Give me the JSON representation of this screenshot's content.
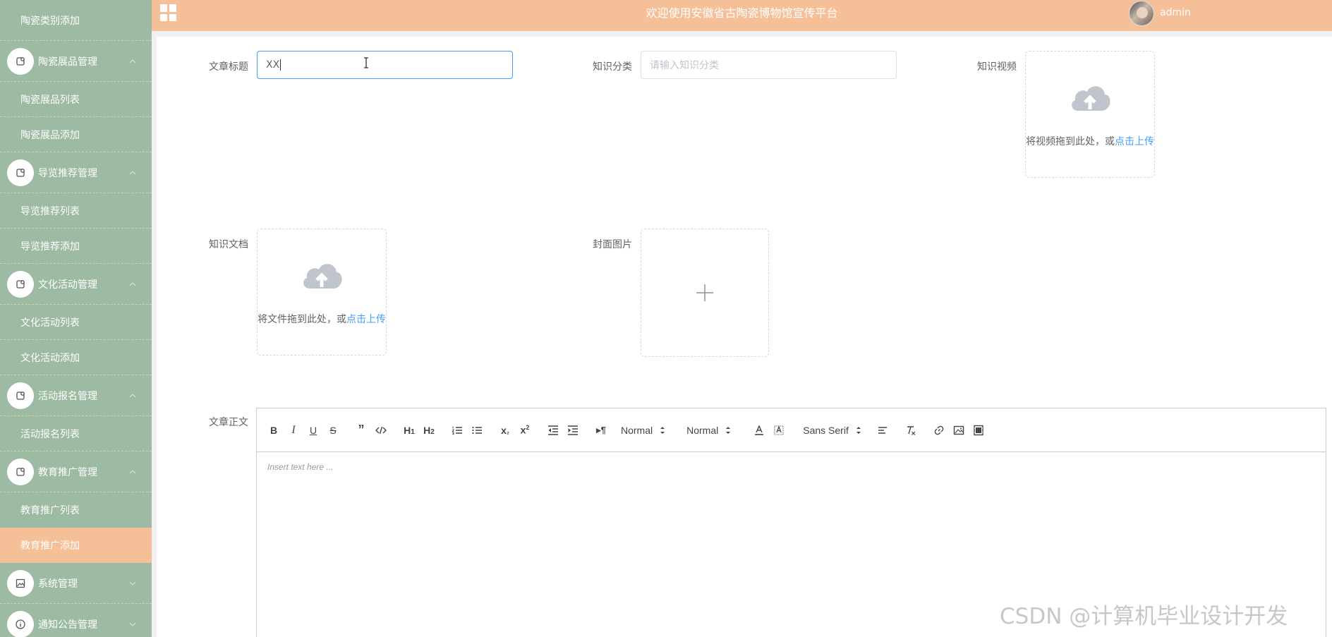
{
  "header": {
    "title": "欢迎使用安徽省古陶瓷博物馆宣传平台",
    "username": "admin",
    "accent_color": "#f5bf98"
  },
  "sidebar": {
    "background": "#9dbaa3",
    "top_item": "陶瓷类别添加",
    "groups": [
      {
        "label": "陶瓷展品管理",
        "icon": "gear-icon",
        "children": [
          "陶瓷展品列表",
          "陶瓷展品添加"
        ]
      },
      {
        "label": "导览推荐管理",
        "icon": "gear-icon",
        "children": [
          "导览推荐列表",
          "导览推荐添加"
        ]
      },
      {
        "label": "文化活动管理",
        "icon": "gear-icon",
        "children": [
          "文化活动列表",
          "文化活动添加"
        ]
      },
      {
        "label": "活动报名管理",
        "icon": "gear-icon",
        "children": [
          "活动报名列表"
        ]
      },
      {
        "label": "教育推广管理",
        "icon": "gear-icon",
        "children": [
          "教育推广列表",
          "教育推广添加"
        ]
      },
      {
        "label": "系统管理",
        "icon": "image-icon",
        "children": []
      },
      {
        "label": "通知公告管理",
        "icon": "info-icon",
        "children": []
      }
    ],
    "active_item": "教育推广添加"
  },
  "form": {
    "title_label": "文章标题",
    "title_value": "XX",
    "category_label": "知识分类",
    "category_placeholder": "请输入知识分类",
    "video_label": "知识视频",
    "video_hint": "将视频拖到此处，或",
    "video_link": "点击上传",
    "doc_label": "知识文档",
    "doc_hint": "将文件拖到此处，或",
    "doc_link": "点击上传",
    "cover_label": "封面图片",
    "body_label": "文章正文"
  },
  "editor": {
    "header_picker": "Normal",
    "size_picker": "Normal",
    "font_picker": "Sans Serif",
    "placeholder": "Insert text here ..."
  },
  "watermark": "CSDN @计算机毕业设计开发"
}
